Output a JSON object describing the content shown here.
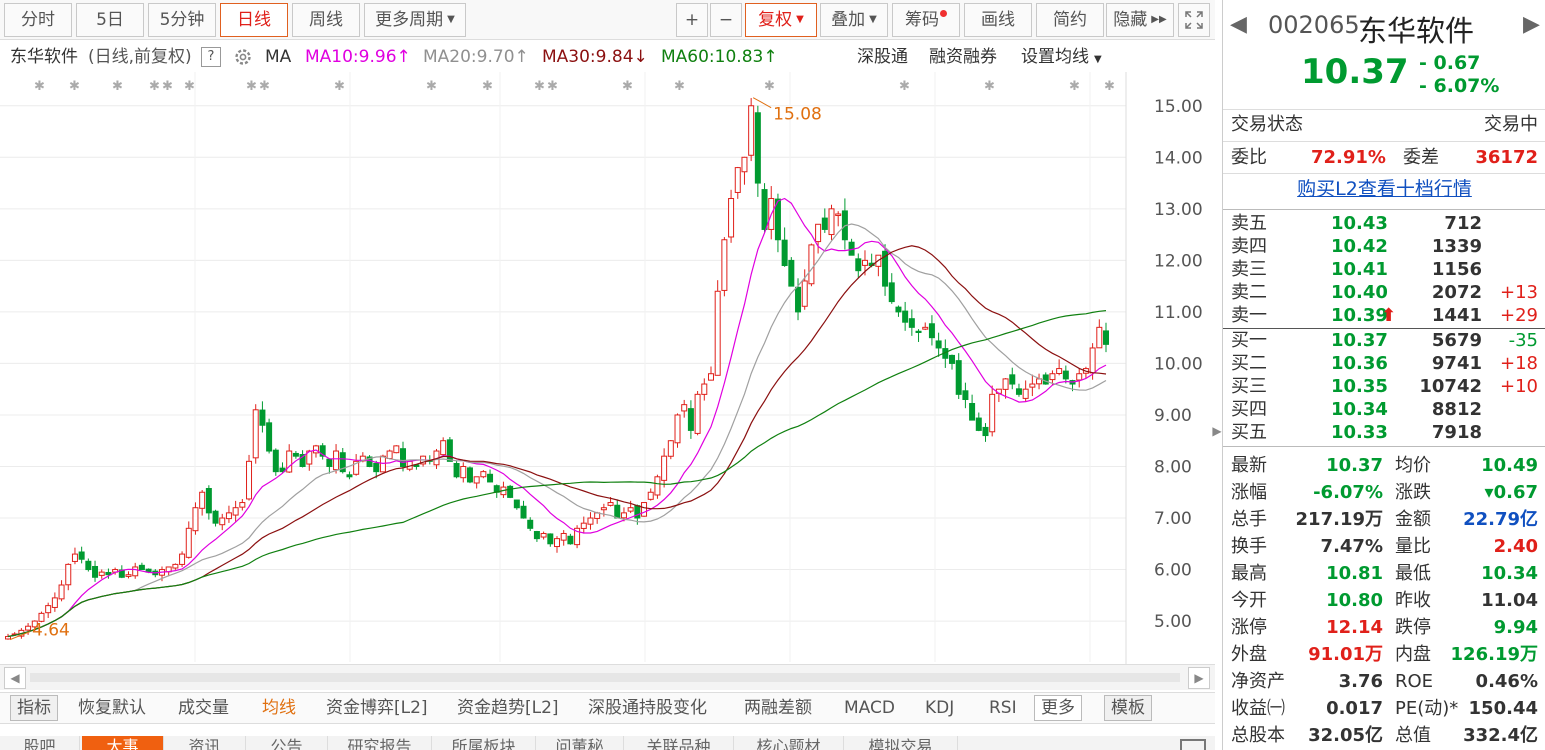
{
  "toolbar": {
    "tabs": [
      "分时",
      "5日",
      "5分钟",
      "日线",
      "周线",
      "更多周期"
    ],
    "buttons": [
      "+",
      "−",
      "复权",
      "叠加",
      "筹码",
      "画线",
      "简约",
      "隐藏"
    ]
  },
  "legend": {
    "stock": "东华软件",
    "mode": "(日线,前复权)",
    "help": "?",
    "ma": "MA",
    "ma10": "MA10:9.96",
    "ma20": "MA20:9.70",
    "ma30": "MA30:9.84",
    "ma60": "MA60:10.83",
    "ma10_arrow": "↑",
    "ma20_arrow": "↑",
    "ma30_arrow": "↓",
    "ma60_arrow": "↑",
    "links": [
      "深股通",
      "融资融券",
      "设置均线"
    ]
  },
  "colors": {
    "up": "#e0201a",
    "down": "#009a30",
    "ma10": "#e000e0",
    "ma20": "#a0a0a0",
    "ma30": "#8b1010",
    "ma60": "#108010",
    "accent": "#f06010"
  },
  "chart_data": {
    "type": "candlestick",
    "title": "",
    "ylim": [
      4.4,
      15.5
    ],
    "yticks": [
      "5.00",
      "6.00",
      "7.00",
      "8.00",
      "9.00",
      "10.00",
      "11.00",
      "12.00",
      "13.00",
      "14.00",
      "15.00"
    ],
    "annotations": [
      {
        "text": "15.08",
        "value": 15.08
      },
      {
        "text": "4.64",
        "value": 4.64
      }
    ],
    "closes": [
      4.7,
      4.75,
      4.82,
      4.9,
      5.0,
      5.15,
      5.3,
      5.45,
      5.7,
      6.1,
      6.3,
      6.2,
      6.0,
      5.85,
      5.95,
      5.9,
      6.0,
      5.85,
      5.9,
      6.05,
      6.0,
      5.95,
      5.9,
      6.0,
      6.05,
      6.1,
      6.3,
      6.8,
      7.2,
      7.5,
      7.1,
      6.9,
      7.0,
      7.1,
      7.2,
      7.3,
      8.1,
      9.1,
      8.8,
      8.3,
      7.9,
      7.9,
      8.3,
      8.2,
      8.0,
      8.3,
      8.4,
      8.2,
      8.0,
      8.3,
      7.9,
      7.8,
      8.1,
      8.2,
      8.0,
      7.9,
      8.2,
      8.3,
      8.4,
      8.0,
      8.1,
      8.0,
      8.2,
      8.1,
      8.3,
      8.5,
      8.1,
      7.8,
      8.0,
      7.7,
      7.8,
      7.9,
      7.7,
      7.5,
      7.6,
      7.4,
      7.2,
      7.0,
      6.8,
      6.6,
      6.7,
      6.5,
      6.6,
      6.7,
      6.5,
      6.8,
      6.9,
      7.0,
      7.1,
      7.2,
      7.3,
      7.0,
      7.1,
      7.2,
      7.0,
      7.3,
      7.5,
      7.8,
      8.2,
      8.5,
      9.0,
      9.2,
      8.7,
      9.4,
      9.6,
      9.8,
      11.4,
      12.4,
      13.2,
      13.8,
      14.0,
      15.0,
      13.5,
      12.6,
      13.2,
      12.4,
      11.9,
      11.5,
      11.0,
      11.6,
      12.3,
      12.7,
      12.6,
      13.0,
      12.9,
      12.4,
      12.1,
      11.8,
      12.0,
      11.9,
      12.1,
      11.5,
      11.2,
      11.0,
      10.8,
      10.7,
      10.6,
      10.7,
      10.5,
      10.3,
      10.1,
      10.0,
      9.4,
      9.3,
      8.9,
      8.7,
      8.6,
      9.4,
      9.5,
      9.7,
      9.6,
      9.4,
      9.5,
      9.6,
      9.7,
      9.6,
      9.8,
      9.9,
      9.7,
      9.6,
      9.8,
      9.9,
      10.3,
      10.7,
      10.37
    ],
    "ma_series": [
      {
        "name": "MA10",
        "value": "9.96"
      },
      {
        "name": "MA20",
        "value": "9.70"
      },
      {
        "name": "MA30",
        "value": "9.84"
      },
      {
        "name": "MA60",
        "value": "10.83"
      }
    ]
  },
  "indicators": {
    "items": [
      "指标",
      "恢复默认",
      "成交量",
      "均线",
      "资金博弈[L2]",
      "资金趋势[L2]",
      "深股通持股变化",
      "两融差额",
      "MACD",
      "KDJ",
      "RSI",
      "更多",
      "模板"
    ]
  },
  "bottom_tabs": [
    "股吧",
    "大事",
    "资讯",
    "公告",
    "研究报告",
    "所属板块",
    "问董秘",
    "关联品种",
    "核心题材",
    "模拟交易"
  ],
  "quote": {
    "code": "002065",
    "name": "东华软件",
    "price": "10.37",
    "change": "- 0.67",
    "change_pct": "- 6.07%",
    "status_label": "交易状态",
    "status_value": "交易中",
    "weibi_label": "委比",
    "weibi_value": "72.91%",
    "weicha_label": "委差",
    "weicha_value": "36172",
    "l2_link": "购买L2查看十档行情",
    "asks": [
      {
        "label": "卖五",
        "price": "10.43",
        "vol": "712",
        "chg": ""
      },
      {
        "label": "卖四",
        "price": "10.42",
        "vol": "1339",
        "chg": ""
      },
      {
        "label": "卖三",
        "price": "10.41",
        "vol": "1156",
        "chg": ""
      },
      {
        "label": "卖二",
        "price": "10.40",
        "vol": "2072",
        "chg": "+13"
      },
      {
        "label": "卖一",
        "price": "10.39",
        "vol": "1441",
        "chg": "+29"
      }
    ],
    "bids": [
      {
        "label": "买一",
        "price": "10.37",
        "vol": "5679",
        "chg": "-35"
      },
      {
        "label": "买二",
        "price": "10.36",
        "vol": "9741",
        "chg": "+18"
      },
      {
        "label": "买三",
        "price": "10.35",
        "vol": "10742",
        "chg": "+10"
      },
      {
        "label": "买四",
        "price": "10.34",
        "vol": "8812",
        "chg": ""
      },
      {
        "label": "买五",
        "price": "10.33",
        "vol": "7918",
        "chg": ""
      }
    ],
    "stats": [
      {
        "l1": "最新",
        "v1": "10.37",
        "c1": "green",
        "l2": "均价",
        "v2": "10.49",
        "c2": "green"
      },
      {
        "l1": "涨幅",
        "v1": "-6.07%",
        "c1": "green",
        "l2": "涨跌",
        "v2": "▾0.67",
        "c2": "green"
      },
      {
        "l1": "总手",
        "v1": "217.19万",
        "c1": "",
        "l2": "金额",
        "v2": "22.79亿",
        "c2": "blue"
      },
      {
        "l1": "换手",
        "v1": "7.47%",
        "c1": "",
        "l2": "量比",
        "v2": "2.40",
        "c2": "red"
      },
      {
        "l1": "最高",
        "v1": "10.81",
        "c1": "green",
        "l2": "最低",
        "v2": "10.34",
        "c2": "green"
      },
      {
        "l1": "今开",
        "v1": "10.80",
        "c1": "green",
        "l2": "昨收",
        "v2": "11.04",
        "c2": ""
      },
      {
        "l1": "涨停",
        "v1": "12.14",
        "c1": "red",
        "l2": "跌停",
        "v2": "9.94",
        "c2": "green"
      },
      {
        "l1": "外盘",
        "v1": "91.01万",
        "c1": "red",
        "l2": "内盘",
        "v2": "126.19万",
        "c2": "green"
      },
      {
        "l1": "净资产",
        "v1": "3.76",
        "c1": "",
        "l2": "ROE",
        "v2": "0.46%",
        "c2": ""
      },
      {
        "l1": "收益㈠",
        "v1": "0.017",
        "c1": "",
        "l2": "PE(动)*",
        "v2": "150.44",
        "c2": ""
      },
      {
        "l1": "总股本",
        "v1": "32.05亿",
        "c1": "",
        "l2": "总值",
        "v2": "332.4亿",
        "c2": ""
      }
    ]
  }
}
